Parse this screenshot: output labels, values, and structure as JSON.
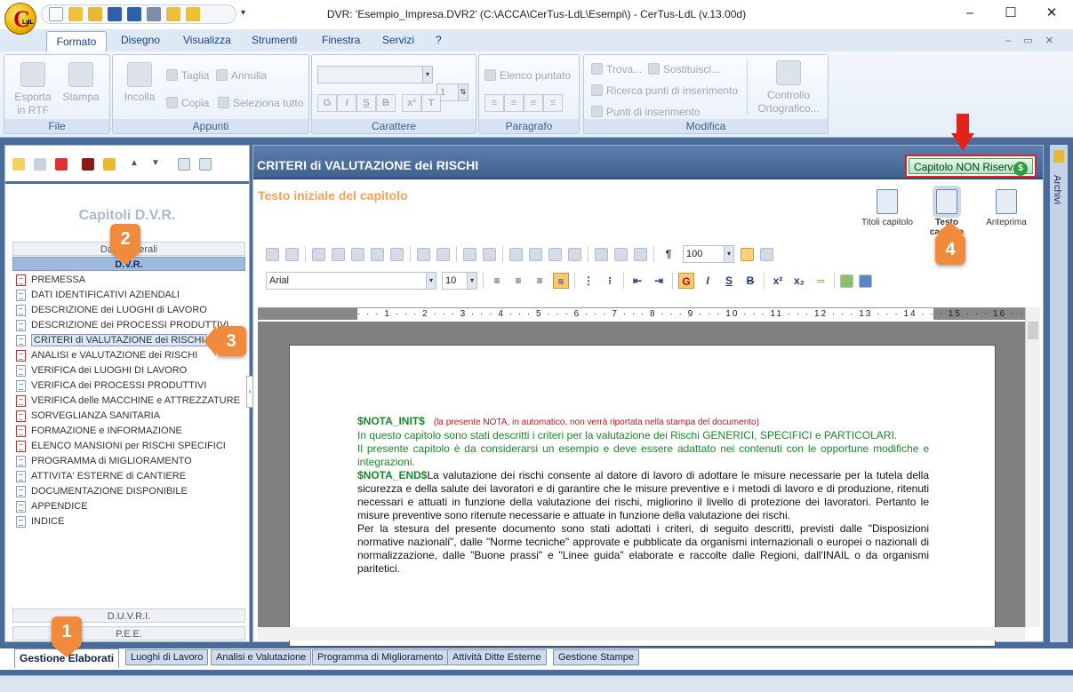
{
  "window": {
    "title": "DVR: 'Esempio_Impresa.DVR2'   (C:\\ACCA\\CerTus-LdL\\Esempi\\) - CerTus-LdL (v.13.00d)",
    "logo_letter": "C",
    "logo_sub": "LdL"
  },
  "menu": {
    "tabs": [
      "Formato",
      "Disegno",
      "Visualizza",
      "Strumenti",
      "Finestra",
      "Servizi",
      "?"
    ]
  },
  "ribbon": {
    "file": {
      "title": "File",
      "export": "Esporta in RTF",
      "print": "Stampa"
    },
    "appunti": {
      "title": "Appunti",
      "paste": "Incolla",
      "cut": "Taglia",
      "copy": "Copia",
      "undo": "Annulla",
      "select_all": "Seleziona tutto"
    },
    "carattere": {
      "title": "Carattere",
      "size": "1",
      "bold": "G",
      "italic": "I",
      "underline": "S",
      "strike": "B"
    },
    "paragrafo": {
      "title": "Paragrafo",
      "bullet": "Elenco puntato"
    },
    "modifica": {
      "title": "Modifica",
      "find": "Trova...",
      "replace": "Sostituisci...",
      "search_points": "Ricerca punti di inserimento",
      "points": "Punti di inserimento",
      "spell": "Controllo Ortografico..."
    }
  },
  "left_panel": {
    "title": "Capitoli  D.V.R.",
    "sections": {
      "dati_generali": "Dati Generali",
      "dvr": "D.V.R.",
      "duvri": "D.U.V.R.I.",
      "pee": "P.E.E."
    },
    "chapters": [
      {
        "label": "PREMESSA",
        "mark": "red"
      },
      {
        "label": "DATI IDENTIFICATIVI AZIENDALI",
        "mark": "normal"
      },
      {
        "label": "DESCRIZIONE dei LUOGHI di LAVORO",
        "mark": "normal"
      },
      {
        "label": "DESCRIZIONE dei PROCESSI PRODUTTIVI",
        "mark": "normal"
      },
      {
        "label": "CRITERI di VALUTAZIONE dei RISCHI",
        "mark": "normal"
      },
      {
        "label": "ANALISI e VALUTAZIONE dei RISCHI",
        "mark": "red"
      },
      {
        "label": "VERIFICA dei LUOGHI DI LAVORO",
        "mark": "normal"
      },
      {
        "label": "VERIFICA dei PROCESSI PRODUTTIVI",
        "mark": "normal"
      },
      {
        "label": "VERIFICA delle MACCHINE e ATTREZZATURE",
        "mark": "red"
      },
      {
        "label": "SORVEGLIANZA SANITARIA",
        "mark": "red"
      },
      {
        "label": "FORMAZIONE e INFORMAZIONE",
        "mark": "red"
      },
      {
        "label": "ELENCO MANSIONI per RISCHI SPECIFICI",
        "mark": "red"
      },
      {
        "label": "PROGRAMMA di MIGLIORAMENTO",
        "mark": "normal"
      },
      {
        "label": "ATTIVITA' ESTERNE di CANTIERE",
        "mark": "normal"
      },
      {
        "label": "DOCUMENTAZIONE DISPONIBILE",
        "mark": "normal"
      },
      {
        "label": "APPENDICE",
        "mark": "normal"
      },
      {
        "label": "INDICE",
        "mark": "normal"
      }
    ]
  },
  "right_panel": {
    "chapter_title": "CRITERI di VALUTAZIONE dei RISCHI",
    "reserved_button": "Capitolo NON Riservato",
    "dollar": "$",
    "subtitle": "Testo iniziale del capitolo",
    "views": {
      "titoli": "Titoli capitolo",
      "testo": "Testo capitolo",
      "anteprima": "Anteprima"
    },
    "zoom": "100",
    "font": "Arial",
    "font_size": "10",
    "fmt": {
      "bold": "G",
      "italic": "I",
      "underline": "S",
      "strike": "B"
    },
    "ruler": "· · · 1 · · · 2 · · · 3 · · · 4 · · · 5 · · · 6 · · · 7 · · · 8 · · · 9 · · · 10 · · · 11 · · · 12 · · · 13 · · · 14 · · · 15 · · · 16 · · · 17 · · · 18 · · · 19 ·"
  },
  "document": {
    "nota_init": "$NOTA_INIT$",
    "nota_comment": "(la presente NOTA, in automatico, non verrà riportata nella stampa del documento)",
    "nota_line1": "In questo capitolo sono stati descritti i criteri per la valutazione dei Rischi GENERICI, SPECIFICI e PARTICOLARI.",
    "nota_line2": "Il presente capitolo è da considerarsi un esempio e deve essere adattato nei contenuti con le opportune modifiche e integrazioni.",
    "nota_end": "$NOTA_END$",
    "para1": "La valutazione dei rischi consente al datore di lavoro di adottare le misure necessarie per la tutela della sicurezza e della salute dei lavoratori e di garantire che le misure preventive e i metodi di lavoro e di produzione, ritenuti necessari e attuati in funzione della valutazione dei rischi, migliorino il livello di protezione dei lavoratori. Pertanto le misure preventive sono ritenute necessarie e attuate in funzione della valutazione dei rischi.",
    "para2": "Per la stesura del presente documento sono stati adottati i criteri, di seguito descritti, previsti dalle \"Disposizioni normative nazionali\", dalle \"Norme tecniche\" approvate e pubblicate da organismi internazionali o europei o nazionali di normalizzazione, dalle \"Buone prassi\" e \"Linee guida\" elaborate e raccolte dalle Regioni, dall'INAIL o da organismi paritetici."
  },
  "sidebar": {
    "label": "Archivi"
  },
  "bottom_tabs": [
    "Gestione Elaborati",
    "Luoghi di Lavoro",
    "Analisi e Valutazione",
    "Programma di Miglioramento",
    "Attività Ditte Esterne",
    "Gestione Stampe"
  ],
  "callouts": [
    "1",
    "2",
    "3",
    "4"
  ],
  "colors": {
    "accent": "#4b6c9a",
    "callout": "#f08a3c",
    "highlight": "#e0241b",
    "subtitle": "#f6a15a",
    "nota": "#1a8a2a"
  }
}
